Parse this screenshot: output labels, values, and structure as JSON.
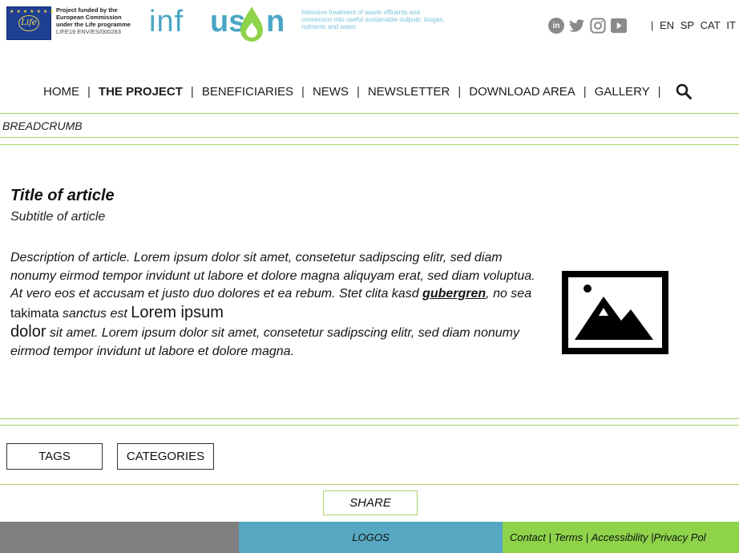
{
  "header": {
    "funded_lines": [
      "Project funded by the",
      "European Commission",
      "under the Life programme"
    ],
    "project_code": "LIFE19 ENV/ES/000283",
    "eu_logo_text": "Life",
    "logo_text_a": "inf",
    "logo_text_b": "us",
    "logo_text_c": "n",
    "tagline": "Intensive treatment of waste effluents and conversion into useful sustainable outputs: biogas, nutrients and water.",
    "social": [
      "linkedin-icon",
      "twitter-icon",
      "instagram-icon",
      "youtube-icon"
    ],
    "languages": [
      "EN",
      "SP",
      "CAT",
      "IT"
    ],
    "lang_separator": "|"
  },
  "nav": {
    "items": [
      "HOME",
      "THE PROJECT",
      "BENEFICIARIES",
      "NEWS",
      "NEWSLETTER",
      "DOWNLOAD AREA",
      "GALLERY"
    ],
    "active_index": 1,
    "separator": "|"
  },
  "breadcrumb": "BREADCRUMB",
  "article": {
    "title": "Title of article",
    "subtitle": "Subtitle of article",
    "desc_1": "Description of article. Lorem ipsum dolor sit amet, consetetur sadipscing elitr, sed diam nonumy eirmod tempor invidunt ut labore et dolore magna aliquyam erat, sed diam voluptua. At vero eos et accusam et justo duo dolores et ea rebum. Stet clita kasd ",
    "desc_link": "gubergren",
    "desc_2": ", no sea ",
    "desc_upright_1": "takimata",
    "desc_3": " sanctus est ",
    "desc_big": "Lorem ipsum",
    "desc_big_2": "dolor",
    "desc_4": " sit amet. Lorem ipsum dolor sit amet, consetetur sadipscing elitr, sed diam nonumy eirmod tempor invidunt ut labore et dolore magna.",
    "image_icon": "image-placeholder-icon"
  },
  "buttons": {
    "tags": "TAGS",
    "categories": "CATEGORIES",
    "share": "SHARE"
  },
  "footer": {
    "logos": "LOGOS",
    "links": [
      "Contact",
      "Terms",
      "Accessibility",
      "Privacy Pol"
    ],
    "link_separator": "|"
  },
  "colors": {
    "accent_green": "#8ed34a",
    "line_green": "#a8d26b",
    "blue": "#57a7c2",
    "grey": "#7f7f7f"
  }
}
